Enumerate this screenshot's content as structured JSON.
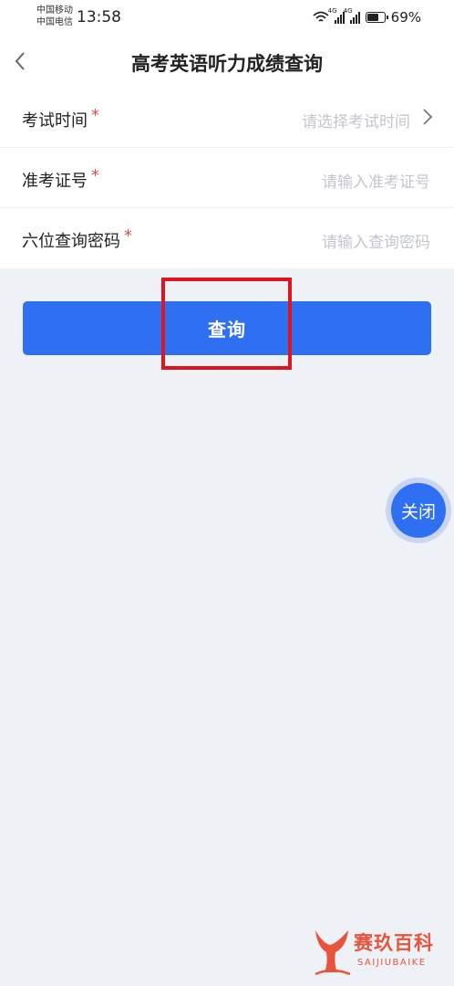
{
  "status_bar": {
    "carrier_1": "中国移动",
    "carrier_2": "中国电信",
    "time": "13:58",
    "network_tag_1": "4G",
    "network_tag_2": "4G",
    "battery_percent_label": "69%",
    "battery_level": 0.69
  },
  "header": {
    "back_icon": "chevron-left-icon",
    "title": "高考英语听力成绩查询"
  },
  "form": {
    "fields": [
      {
        "label": "考试时间",
        "required_mark": "*",
        "placeholder": "请选择考试时间",
        "trailing_icon": "chevron-right-icon"
      },
      {
        "label": "准考证号",
        "required_mark": "*",
        "placeholder": "请输入准考证号"
      },
      {
        "label": "六位查询密码",
        "required_mark": "*",
        "placeholder": "请输入查询密码"
      }
    ]
  },
  "submit_button": {
    "label": "查询"
  },
  "floating_close": {
    "label": "关闭"
  },
  "watermark": {
    "name": "赛玖百科",
    "sub": "SAIJIUBAIKE"
  },
  "colors": {
    "primary": "#2f6ff2",
    "highlight_box": "#e0141c",
    "required_star": "#e34a4a",
    "page_background": "#eef1f6",
    "watermark": "#e8533b"
  }
}
